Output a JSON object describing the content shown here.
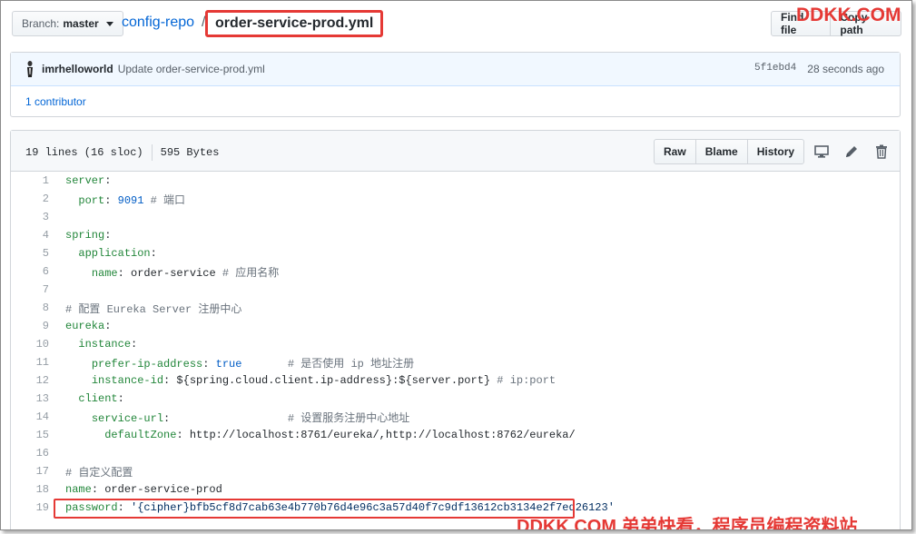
{
  "header": {
    "branch_label": "Branch:",
    "branch_value": "master",
    "repo": "config-repo",
    "separator": "/",
    "file": "order-service-prod.yml",
    "find_file": "Find file",
    "copy_path": "Copy path"
  },
  "watermark": {
    "top": "DDKK.COM",
    "bottom": "DDKK.COM 弟弟快看，程序员编程资料站"
  },
  "commit": {
    "author": "imrhelloworld",
    "message": "Update order-service-prod.yml",
    "sha": "5f1ebd4",
    "time": "28 seconds ago",
    "contributors": "1 contributor"
  },
  "file": {
    "lines_info": "19 lines (16 sloc)",
    "size": "595 Bytes",
    "raw": "Raw",
    "blame": "Blame",
    "history": "History"
  },
  "code": {
    "line_numbers": [
      "1",
      "2",
      "3",
      "4",
      "5",
      "6",
      "7",
      "8",
      "9",
      "10",
      "11",
      "12",
      "13",
      "14",
      "15",
      "16",
      "17",
      "18",
      "19"
    ]
  },
  "colors": {
    "accent_red": "#e53935",
    "link_blue": "#0366d6",
    "yaml_key_green": "#22863a"
  }
}
